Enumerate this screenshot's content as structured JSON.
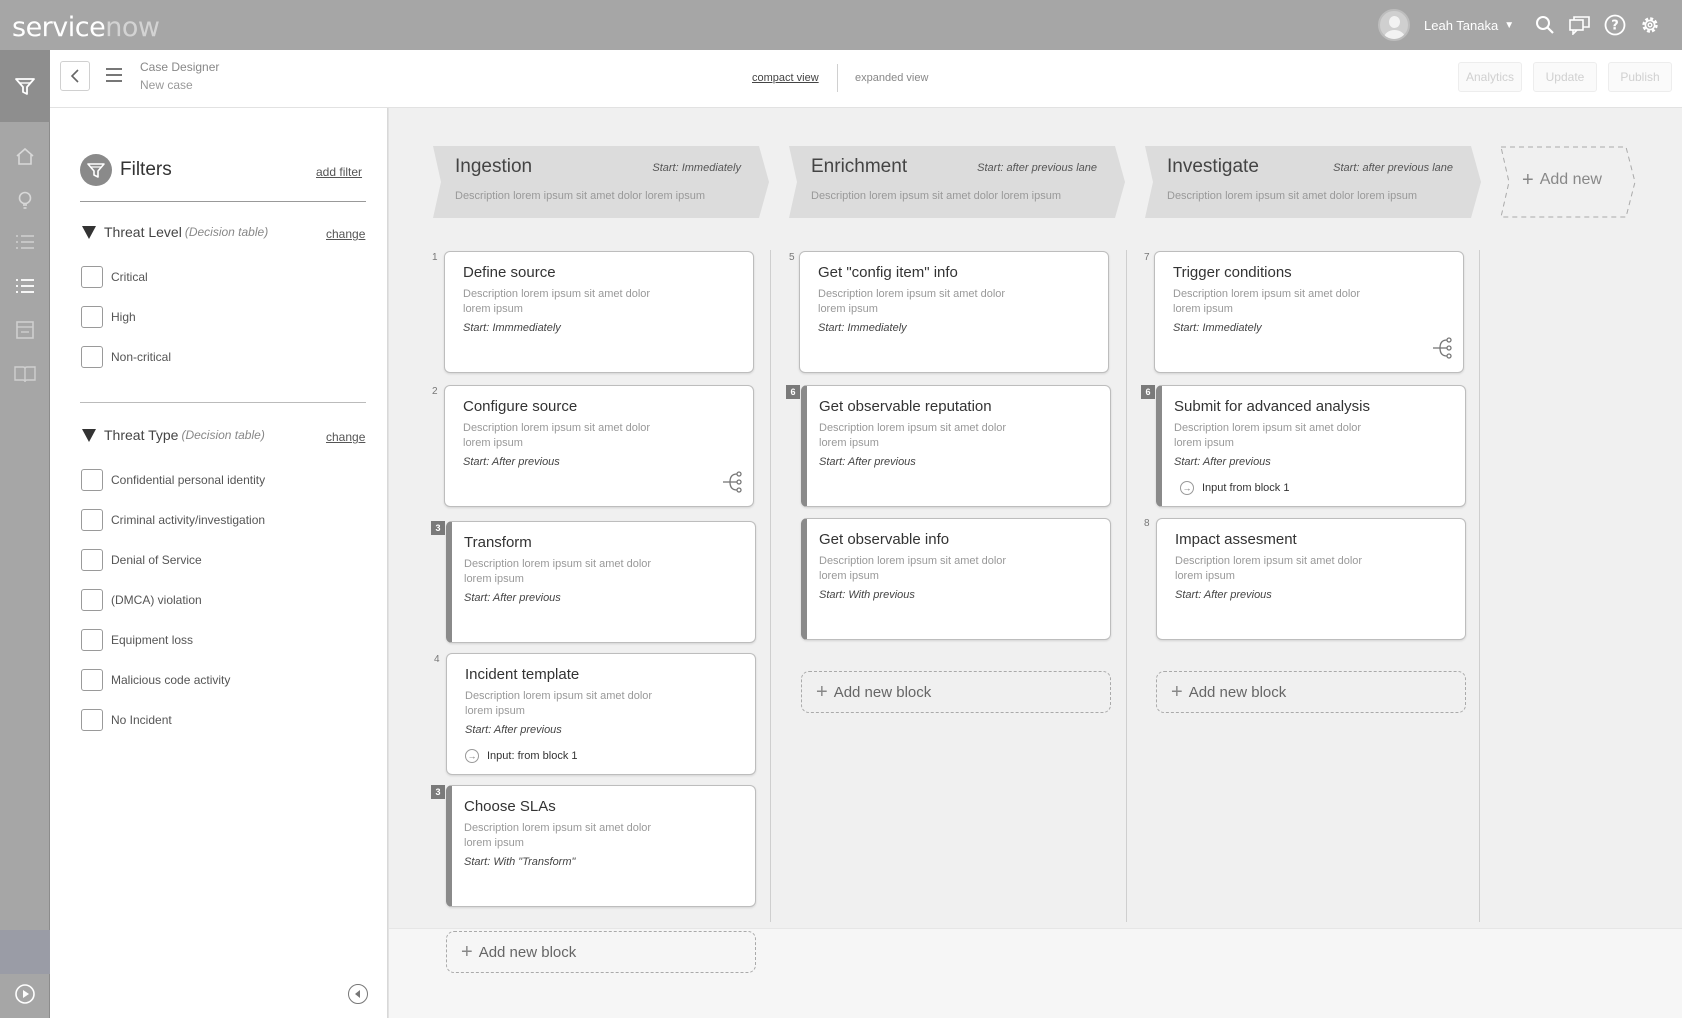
{
  "app": {
    "logo_main": "service",
    "logo_faint": "now",
    "user_name": "Leah Tanaka"
  },
  "header": {
    "title": "Case Designer",
    "subtitle": "New case",
    "view_compact": "compact view",
    "view_expanded": "expanded view",
    "buttons": {
      "analytics": "Analytics",
      "update": "Update",
      "publish": "Publish"
    }
  },
  "filters": {
    "title": "Filters",
    "add_filter": "add filter",
    "change_label": "change",
    "groups": [
      {
        "name": "Threat Level",
        "note": "(Decision table)",
        "options": [
          "Critical",
          "High",
          "Non-critical"
        ]
      },
      {
        "name": "Threat Type",
        "note": "(Decision table)",
        "options": [
          "Confidential personal identity",
          "Criminal activity/investigation",
          "Denial of Service",
          "(DMCA) violation",
          "Equipment loss",
          "Malicious code activity",
          "No Incident"
        ]
      }
    ]
  },
  "lanes": [
    {
      "title": "Ingestion",
      "start": "Start: Immediately",
      "desc": "Description lorem ipsum sit amet dolor lorem ipsum",
      "blocks": [
        {
          "num": "1",
          "title": "Define source",
          "desc": "Description lorem ipsum sit amet dolor lorem ipsum",
          "start": "Start: Immmediately"
        },
        {
          "num": "2",
          "title": "Configure source",
          "desc": "Description lorem ipsum sit amet dolor lorem ipsum",
          "start": "Start: After previous"
        },
        {
          "num": "3",
          "title": "Transform",
          "desc": "Description lorem ipsum sit amet dolor lorem ipsum",
          "start": "Start: After previous"
        },
        {
          "num": "4",
          "title": "Incident template",
          "desc": "Description lorem ipsum sit amet dolor lorem ipsum",
          "start": "Start: After previous",
          "input": "Input: from block 1"
        },
        {
          "num": "3",
          "title": "Choose SLAs",
          "desc": "Description lorem ipsum sit amet dolor lorem ipsum",
          "start": "Start: With \"Transform\""
        }
      ],
      "add_block": "Add new block"
    },
    {
      "title": "Enrichment",
      "start": "Start: after previous lane",
      "desc": "Description lorem ipsum sit amet dolor lorem ipsum",
      "blocks": [
        {
          "num": "5",
          "title": "Get \"config item\" info",
          "desc": "Description lorem ipsum sit amet dolor lorem ipsum",
          "start": "Start: Immediately"
        },
        {
          "num": "6",
          "title": "Get observable reputation",
          "desc": "Description lorem ipsum sit amet dolor lorem ipsum",
          "start": "Start: After previous"
        },
        {
          "title": "Get observable info",
          "desc": "Description lorem ipsum sit amet dolor lorem ipsum",
          "start": "Start: With previous"
        }
      ],
      "add_block": "Add new block"
    },
    {
      "title": "Investigate",
      "start": "Start: after previous lane",
      "desc": "Description lorem ipsum sit amet dolor lorem ipsum",
      "blocks": [
        {
          "num": "7",
          "title": "Trigger conditions",
          "desc": "Description lorem ipsum sit amet dolor lorem ipsum",
          "start": "Start: Immediately"
        },
        {
          "num": "6",
          "title": "Submit for advanced analysis",
          "desc": "Description lorem ipsum sit amet dolor lorem ipsum",
          "start": "Start: After previous",
          "input": "Input from block 1"
        },
        {
          "num": "8",
          "title": "Impact assesment",
          "desc": "Description lorem ipsum sit amet dolor lorem ipsum",
          "start": "Start: After previous"
        }
      ],
      "add_block": "Add new block"
    }
  ],
  "add_new_lane": "Add new"
}
